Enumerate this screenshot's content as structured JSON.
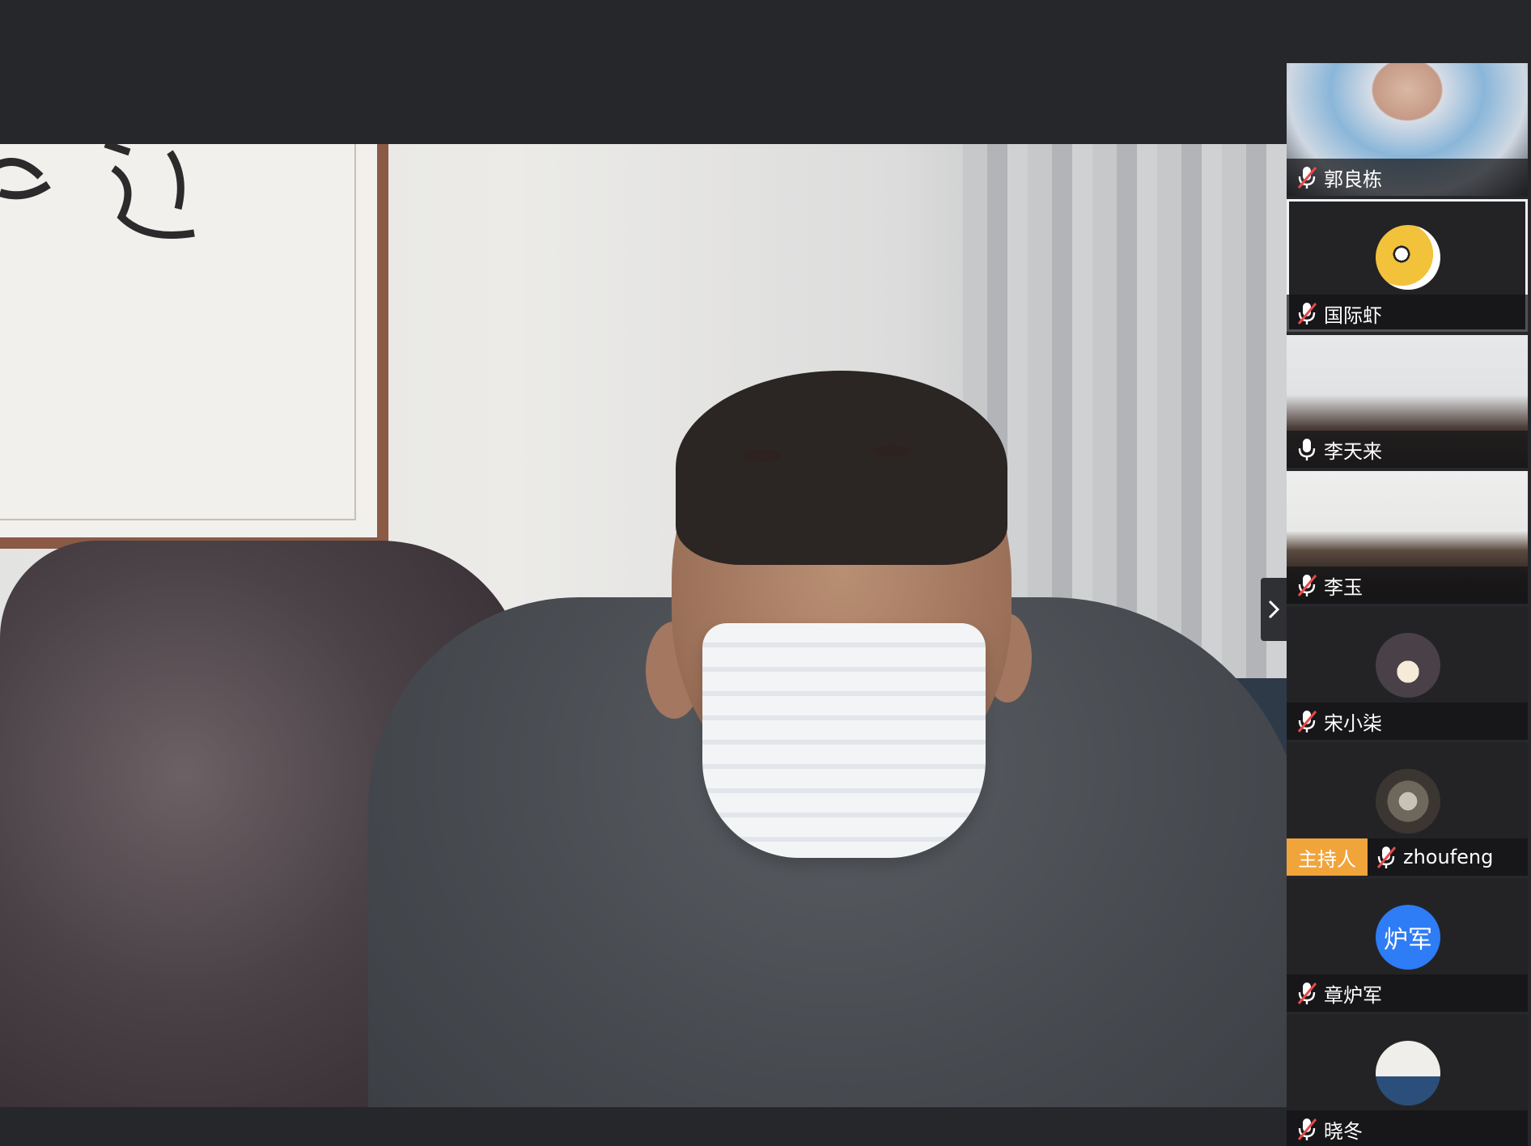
{
  "participants": [
    {
      "name": "郭良栋",
      "muted": true,
      "video": "camera"
    },
    {
      "name": "国际虾",
      "muted": true,
      "video": "avatar",
      "active": true
    },
    {
      "name": "李天来",
      "muted": false,
      "video": "camera"
    },
    {
      "name": "李玉",
      "muted": true,
      "video": "camera"
    },
    {
      "name": "宋小柒",
      "muted": true,
      "video": "avatar"
    },
    {
      "name": "zhoufeng",
      "muted": true,
      "video": "avatar",
      "host_badge": "主持人"
    },
    {
      "name": "章炉军",
      "muted": true,
      "video": "letter-avatar",
      "avatar_text": "炉军"
    },
    {
      "name": "晓冬",
      "muted": true,
      "video": "avatar"
    }
  ],
  "icons": {
    "muted_mic": "mic-muted-icon",
    "mic": "mic-icon",
    "expand": "chevron-right-icon"
  },
  "colors": {
    "background": "#26272a",
    "host_badge": "#f0a43a",
    "muted_icon": "#e8494b",
    "letter_avatar": "#2e7cf6"
  }
}
